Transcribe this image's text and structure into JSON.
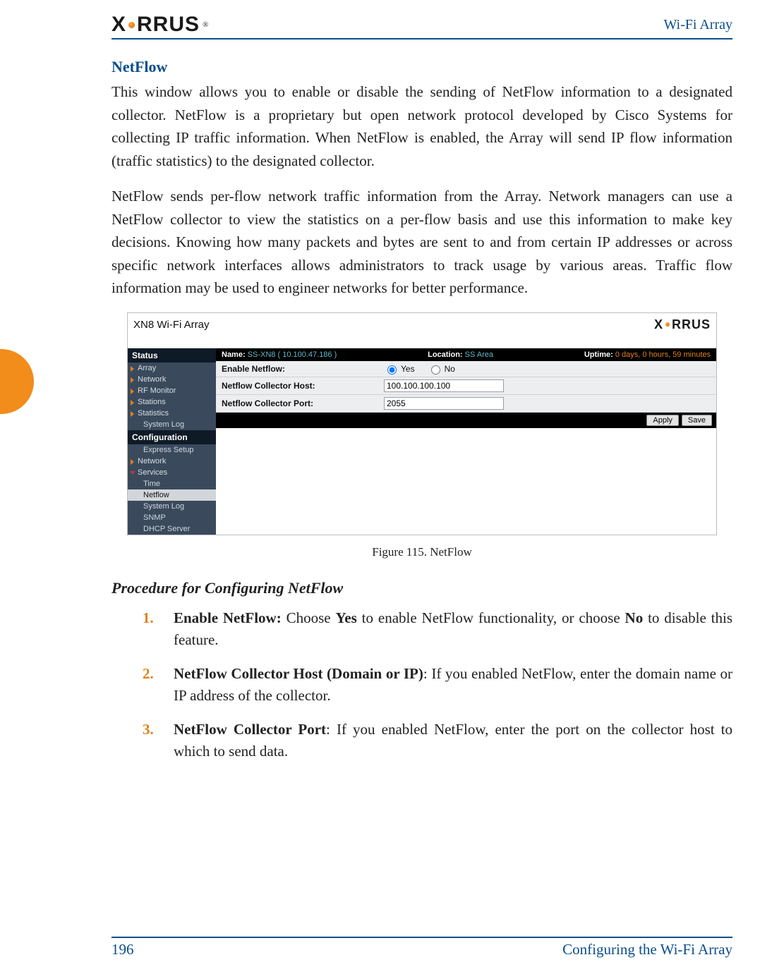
{
  "header": {
    "running_head": "Wi-Fi Array",
    "logo_text": "XIRRUS",
    "logo_reg": "®"
  },
  "section": {
    "title": "NetFlow",
    "para1": "This window allows you to enable or disable the sending of NetFlow information to a designated collector. NetFlow is a proprietary but open network protocol developed by Cisco Systems for collecting IP traffic information. When NetFlow is enabled, the Array will send IP flow information (traffic statistics) to the designated collector.",
    "para2": "NetFlow sends per-flow network traffic information from the Array. Network managers can use a NetFlow collector to view the statistics on a per-flow basis and use this information to make key decisions. Knowing how many packets and bytes are sent to and from certain IP addresses or across specific network interfaces allows administrators to track usage by various areas. Traffic flow information may be used to engineer networks for better performance."
  },
  "figure": {
    "window_title": "XN8 Wi-Fi Array",
    "logo_text": "XIRRUS",
    "status": {
      "name_label": "Name:",
      "name_value": "SS-XN8   ( 10.100.47.186 )",
      "location_label": "Location:",
      "location_value": "SS Area",
      "uptime_label": "Uptime:",
      "uptime_value": "0 days, 0 hours, 59 minutes"
    },
    "sidebar": {
      "status_hdr": "Status",
      "status_items": [
        "Array",
        "Network",
        "RF Monitor",
        "Stations",
        "Statistics",
        "System Log"
      ],
      "config_hdr": "Configuration",
      "config_items": [
        "Express Setup",
        "Network",
        "Services"
      ],
      "services_sub": [
        "Time",
        "Netflow",
        "System Log",
        "SNMP",
        "DHCP Server"
      ]
    },
    "form": {
      "row1_label": "Enable Netflow:",
      "row1_yes": "Yes",
      "row1_no": "No",
      "row2_label": "Netflow Collector Host:",
      "row2_value": "100.100.100.100",
      "row3_label": "Netflow Collector Port:",
      "row3_value": "2055",
      "btn_apply": "Apply",
      "btn_save": "Save"
    },
    "caption": "Figure 115. NetFlow"
  },
  "procedure": {
    "heading": "Procedure for Configuring NetFlow",
    "steps": [
      {
        "bold": "Enable NetFlow: ",
        "rest_a": "Choose ",
        "b2": "Yes",
        "rest_b": " to enable NetFlow functionality, or choose ",
        "b3": "No",
        "rest_c": " to disable this feature."
      },
      {
        "bold": "NetFlow Collector Host (Domain or IP)",
        "rest_a": ": If you enabled NetFlow, enter the domain name or IP address of the collector.",
        "b2": "",
        "rest_b": "",
        "b3": "",
        "rest_c": ""
      },
      {
        "bold": "NetFlow Collector Port",
        "rest_a": ": If you enabled NetFlow, enter the port on the collector host to which to send data.",
        "b2": "",
        "rest_b": "",
        "b3": "",
        "rest_c": ""
      }
    ]
  },
  "footer": {
    "page_number": "196",
    "title": "Configuring the Wi-Fi Array"
  }
}
